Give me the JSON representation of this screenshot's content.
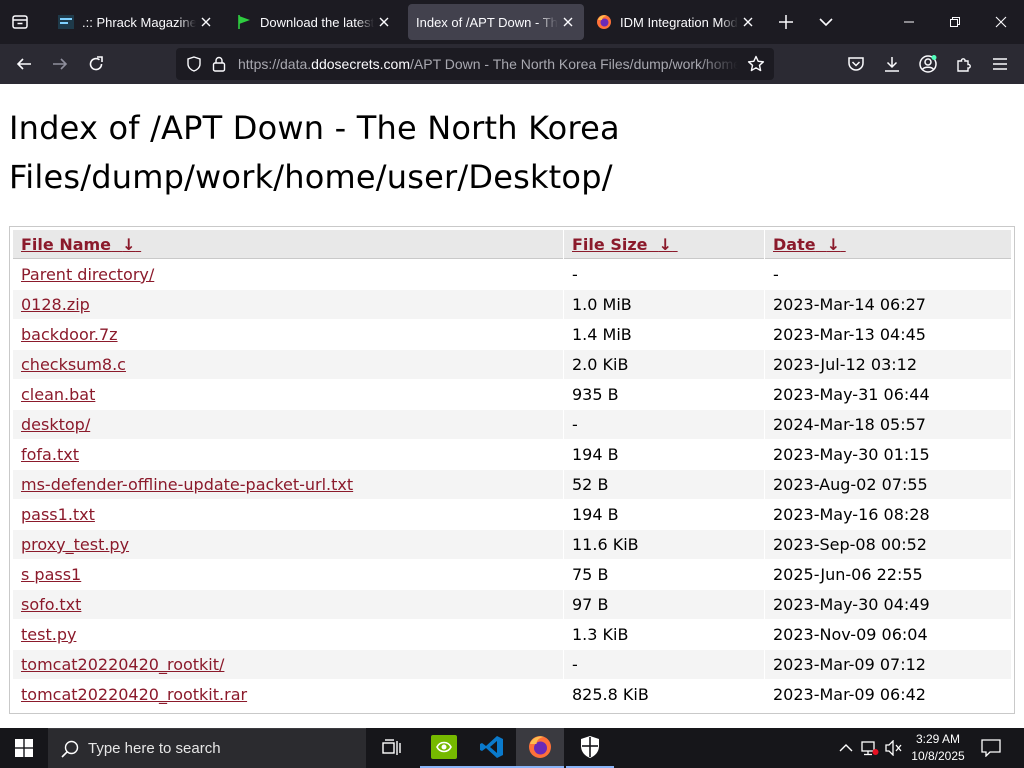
{
  "browser": {
    "tabs": [
      {
        "title": ".:: Phrack Magazine ::.",
        "icon": "phrack-favicon",
        "active": false
      },
      {
        "title": "Download the latest free",
        "icon": "green-flag-favicon",
        "active": false
      },
      {
        "title": "Index of /APT Down - The North Korea Files",
        "icon": "none",
        "active": true
      },
      {
        "title": "IDM Integration Module",
        "icon": "firefox-favicon",
        "active": false
      }
    ],
    "url_prefix": "https://data.",
    "url_domain": "ddosecrets.com",
    "url_path": "/APT Down - The North Korea Files/dump/work/home/user/Desktop/"
  },
  "page": {
    "title": "Index of /APT Down - The North Korea Files/dump/work/home/user/Desktop/",
    "columns": {
      "name": "File Name",
      "size": "File Size",
      "date": "Date",
      "sort_glyph": "↓"
    },
    "rows": [
      {
        "name": "Parent directory/",
        "size": "-",
        "date": "-"
      },
      {
        "name": "0128.zip",
        "size": "1.0 MiB",
        "date": "2023-Mar-14 06:27"
      },
      {
        "name": "backdoor.7z",
        "size": "1.4 MiB",
        "date": "2023-Mar-13 04:45"
      },
      {
        "name": "checksum8.c",
        "size": "2.0 KiB",
        "date": "2023-Jul-12 03:12"
      },
      {
        "name": "clean.bat",
        "size": "935 B",
        "date": "2023-May-31 06:44"
      },
      {
        "name": "desktop/",
        "size": "-",
        "date": "2024-Mar-18 05:57"
      },
      {
        "name": "fofa.txt",
        "size": "194 B",
        "date": "2023-May-30 01:15"
      },
      {
        "name": "ms-defender-offline-update-packet-url.txt",
        "size": "52 B",
        "date": "2023-Aug-02 07:55"
      },
      {
        "name": "pass1.txt",
        "size": "194 B",
        "date": "2023-May-16 08:28"
      },
      {
        "name": "proxy_test.py",
        "size": "11.6 KiB",
        "date": "2023-Sep-08 00:52"
      },
      {
        "name": "s pass1",
        "size": "75 B",
        "date": "2025-Jun-06 22:55"
      },
      {
        "name": "sofo.txt",
        "size": "97 B",
        "date": "2023-May-30 04:49"
      },
      {
        "name": "test.py",
        "size": "1.3 KiB",
        "date": "2023-Nov-09 06:04"
      },
      {
        "name": "tomcat20220420_rootkit/",
        "size": "-",
        "date": "2023-Mar-09 07:12"
      },
      {
        "name": "tomcat20220420_rootkit.rar",
        "size": "825.8 KiB",
        "date": "2023-Mar-09 06:42"
      }
    ]
  },
  "taskbar": {
    "search_placeholder": "Type here to search",
    "time": "3:29 AM",
    "date": "10/8/2025",
    "apps": [
      "task-view",
      "nvidia",
      "vscode",
      "firefox",
      "security"
    ]
  },
  "colors": {
    "link": "#8b1a2b",
    "tabbar_bg": "#1c1b22",
    "toolbar_bg": "#2b2a33",
    "active_tab_bg": "#42414d"
  }
}
